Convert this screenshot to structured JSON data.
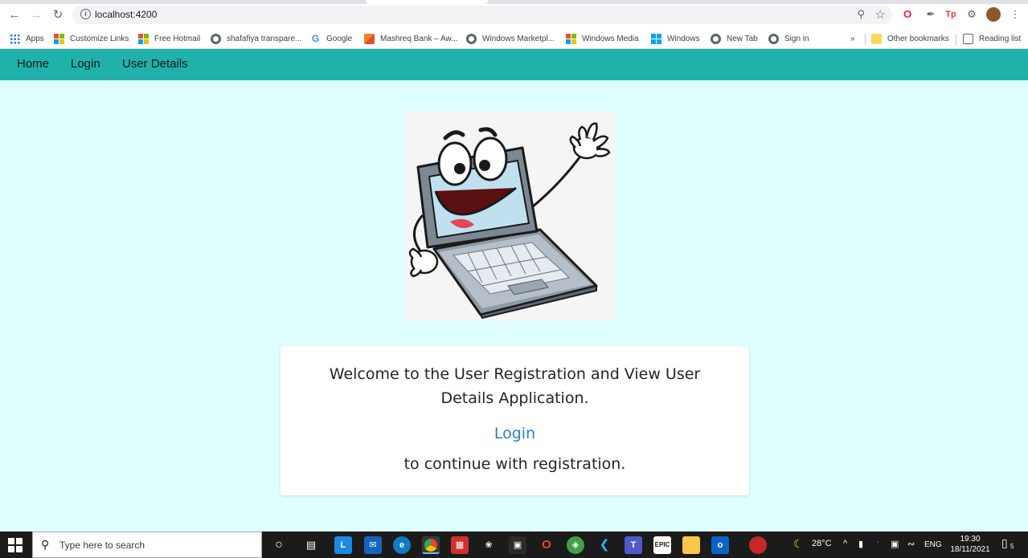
{
  "browser": {
    "url": "localhost:4200",
    "bookmarks": [
      {
        "label": "Apps",
        "icon": "apps-grid-icon"
      },
      {
        "label": "Customize Links",
        "icon": "microsoft-icon"
      },
      {
        "label": "Free Hotmail",
        "icon": "microsoft-icon"
      },
      {
        "label": "shafafiya transpare...",
        "icon": "globe-icon"
      },
      {
        "label": "Google",
        "icon": "google-icon"
      },
      {
        "label": "Mashreq Bank – Aw...",
        "icon": "mashreq-icon"
      },
      {
        "label": "Windows Marketpl...",
        "icon": "globe-icon"
      },
      {
        "label": "Windows Media",
        "icon": "microsoft-icon"
      },
      {
        "label": "Windows",
        "icon": "windows-icon"
      },
      {
        "label": "New Tab",
        "icon": "globe-icon"
      },
      {
        "label": "Sign in",
        "icon": "globe-icon"
      }
    ],
    "overflow_label": "»",
    "other_bookmarks": "Other bookmarks",
    "reading_list": "Reading list"
  },
  "app_nav": {
    "items": [
      "Home",
      "Login",
      "User Details"
    ],
    "color": "#20b2aa"
  },
  "main": {
    "welcome_text": "Welcome to the User Registration and View User Details Application.",
    "login_link": "Login",
    "continue_text": "to continue with registration."
  },
  "taskbar": {
    "search_placeholder": "Type here to search",
    "temperature": "28°C",
    "language": "ENG",
    "time": "19:30",
    "date": "18/11/2021",
    "notification_count": "5"
  },
  "colors": {
    "page_background": "#dffefe",
    "link": "#2a7ed2"
  }
}
